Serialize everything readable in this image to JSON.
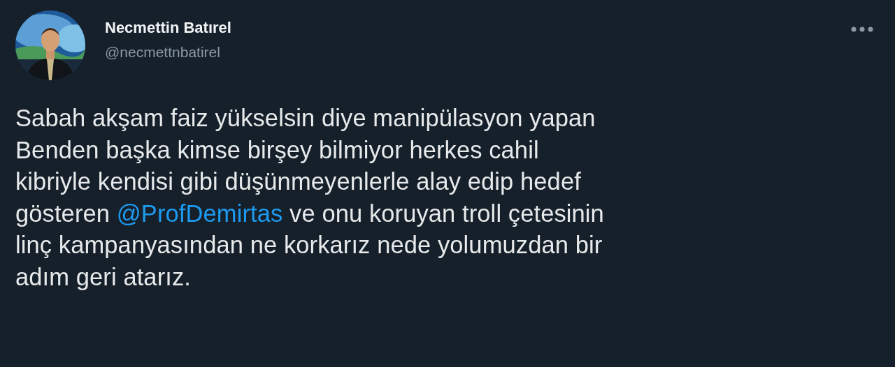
{
  "author": {
    "name": "Necmettin Batırel",
    "handle": "@necmettnbatirel"
  },
  "tweet": {
    "text_before": "Sabah akşam faiz yükselsin diye manipülasyon yapan\nBenden başka kimse birşey bilmiyor herkes cahil\nkibriyle kendisi gibi düşünmeyenlerle alay edip hedef\ngösteren ",
    "mention": "@ProfDemirtas",
    "text_after": " ve onu koruyan troll çetesinin\nlinç kampanyasından ne korkarız nede yolumuzdan bir\nadım geri atarız."
  }
}
